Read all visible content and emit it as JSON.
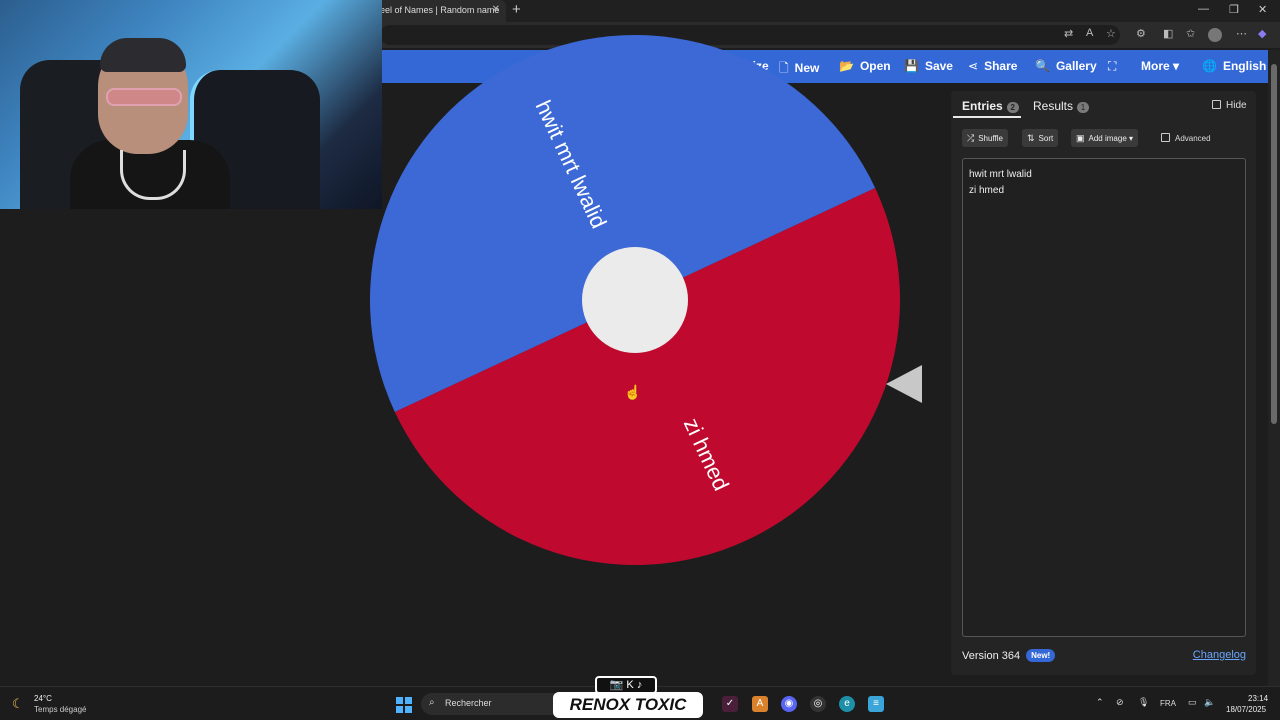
{
  "browser": {
    "tab_title": "eel of Names | Random name",
    "tab_close": "✕",
    "new_tab": "+",
    "window_controls": [
      "—",
      "❐",
      "✕"
    ]
  },
  "nav": {
    "items": [
      {
        "icon": "palette-icon",
        "glyph": "🎨",
        "label": "Customize"
      },
      {
        "icon": "file-icon",
        "glyph": "🗋",
        "label": "New"
      },
      {
        "icon": "folder-icon",
        "glyph": "📂",
        "label": "Open"
      },
      {
        "icon": "save-icon",
        "glyph": "💾",
        "label": "Save"
      },
      {
        "icon": "share-icon",
        "glyph": "⋖",
        "label": "Share"
      },
      {
        "icon": "search-icon",
        "glyph": "🔍",
        "label": "Gallery"
      },
      {
        "icon": "fullscreen-icon",
        "glyph": "⛶",
        "label": ""
      },
      {
        "icon": "chevron-down-icon",
        "glyph": "▾",
        "label": "More"
      },
      {
        "icon": "globe-icon",
        "glyph": "🌐",
        "label": "English"
      }
    ]
  },
  "wheel": {
    "slices": [
      {
        "label": "hwit mrt lwalid",
        "color": "#3c69d5"
      },
      {
        "label": "zi hmed",
        "color": "#c0092f"
      }
    ],
    "hub_color": "#ebebeb",
    "pointer_color": "#c8c8c8"
  },
  "panel": {
    "tabs": [
      {
        "label": "Entries",
        "count": "2"
      },
      {
        "label": "Results",
        "count": "1"
      }
    ],
    "hide_label": "Hide",
    "tools": {
      "shuffle": "Shuffle",
      "sort": "Sort",
      "add_image": "Add image",
      "advanced": "Advanced"
    },
    "entries": [
      "hwit mrt lwalid",
      "zi hmed"
    ],
    "version": "Version 364",
    "new_badge": "New!",
    "changelog": "Changelog"
  },
  "taskbar": {
    "temperature": "24°C",
    "weather": "Temps dégagé",
    "search_placeholder": "Rechercher",
    "language": "FRA",
    "time": "23:14",
    "date": "18/07/2025"
  },
  "watermark": {
    "text": "RENOX TOXIC"
  }
}
